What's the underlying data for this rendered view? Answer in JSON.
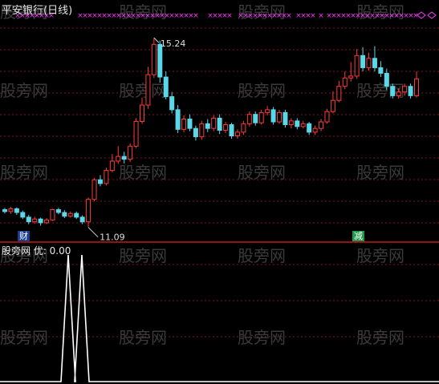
{
  "title": "平安银行(日线)",
  "indicator_label": "股旁网 优: 0.00",
  "badges": {
    "left": "财",
    "right": "减"
  },
  "watermark": "股旁网",
  "colors": {
    "up": "#ff3a3a",
    "down": "#5ad7e8",
    "cross": "#ff33ff",
    "grid": "#7a1a1a",
    "divider": "#c01a1a",
    "line": "#ffffff"
  },
  "chart_data": [
    {
      "type": "candlestick",
      "title": "平安银行(日线)",
      "ylim": [
        10.9,
        15.5
      ],
      "high_label": "15.24",
      "low_label": "11.09",
      "candles": [
        [
          11.56,
          11.52,
          11.6,
          11.48
        ],
        [
          11.52,
          11.58,
          11.62,
          11.47
        ],
        [
          11.58,
          11.5,
          11.61,
          11.45
        ],
        [
          11.5,
          11.4,
          11.54,
          11.36
        ],
        [
          11.4,
          11.3,
          11.45,
          11.25
        ],
        [
          11.3,
          11.36,
          11.41,
          11.26
        ],
        [
          11.36,
          11.28,
          11.39,
          11.22
        ],
        [
          11.28,
          11.34,
          11.38,
          11.25
        ],
        [
          11.34,
          11.56,
          11.58,
          11.32
        ],
        [
          11.56,
          11.5,
          11.6,
          11.46
        ],
        [
          11.5,
          11.42,
          11.55,
          11.38
        ],
        [
          11.42,
          11.48,
          11.52,
          11.39
        ],
        [
          11.48,
          11.4,
          11.52,
          11.36
        ],
        [
          11.4,
          11.3,
          11.44,
          11.25
        ],
        [
          11.3,
          11.78,
          11.82,
          11.18
        ],
        [
          11.78,
          12.2,
          12.24,
          11.74
        ],
        [
          12.2,
          12.12,
          12.3,
          12.06
        ],
        [
          12.12,
          12.4,
          12.46,
          12.08
        ],
        [
          12.4,
          12.6,
          12.75,
          12.36
        ],
        [
          12.6,
          12.7,
          12.92,
          12.54
        ],
        [
          12.7,
          12.64,
          12.8,
          12.55
        ],
        [
          12.64,
          12.92,
          12.98,
          12.58
        ],
        [
          12.92,
          13.45,
          13.52,
          12.88
        ],
        [
          13.45,
          13.8,
          13.96,
          13.4
        ],
        [
          13.8,
          14.45,
          14.62,
          13.72
        ],
        [
          14.45,
          15.1,
          15.24,
          14.38
        ],
        [
          15.1,
          14.4,
          15.18,
          14.28
        ],
        [
          14.4,
          13.98,
          14.52,
          13.92
        ],
        [
          13.98,
          13.7,
          14.08,
          13.62
        ],
        [
          13.7,
          13.28,
          13.8,
          13.2
        ],
        [
          13.28,
          13.5,
          13.58,
          13.22
        ],
        [
          13.5,
          13.3,
          13.6,
          13.24
        ],
        [
          13.3,
          13.12,
          13.36,
          13.04
        ],
        [
          13.12,
          13.4,
          13.46,
          13.06
        ],
        [
          13.4,
          13.3,
          13.5,
          13.22
        ],
        [
          13.3,
          13.52,
          13.58,
          13.24
        ],
        [
          13.52,
          13.26,
          13.6,
          13.18
        ],
        [
          13.26,
          13.38,
          13.44,
          13.2
        ],
        [
          13.38,
          13.14,
          13.42,
          13.08
        ],
        [
          13.14,
          13.22,
          13.28,
          13.08
        ],
        [
          13.22,
          13.4,
          13.46,
          13.16
        ],
        [
          13.4,
          13.6,
          13.66,
          13.34
        ],
        [
          13.6,
          13.42,
          13.66,
          13.36
        ],
        [
          13.42,
          13.64,
          13.7,
          13.38
        ],
        [
          13.64,
          13.7,
          13.78,
          13.58
        ],
        [
          13.7,
          13.44,
          13.76,
          13.38
        ],
        [
          13.44,
          13.64,
          13.7,
          13.4
        ],
        [
          13.64,
          13.38,
          13.7,
          13.32
        ],
        [
          13.38,
          13.46,
          13.52,
          13.3
        ],
        [
          13.46,
          13.34,
          13.52,
          13.28
        ],
        [
          13.34,
          13.4,
          13.46,
          13.3
        ],
        [
          13.4,
          13.22,
          13.44,
          13.16
        ],
        [
          13.22,
          13.3,
          13.36,
          13.16
        ],
        [
          13.3,
          13.44,
          13.5,
          13.24
        ],
        [
          13.44,
          13.66,
          13.72,
          13.4
        ],
        [
          13.66,
          13.9,
          14.1,
          13.62
        ],
        [
          13.9,
          14.2,
          14.32,
          13.86
        ],
        [
          14.2,
          14.38,
          14.52,
          14.14
        ],
        [
          14.38,
          14.42,
          14.72,
          14.3
        ],
        [
          14.42,
          14.86,
          15.0,
          14.36
        ],
        [
          14.86,
          14.6,
          15.04,
          14.52
        ],
        [
          14.6,
          14.8,
          14.92,
          14.54
        ],
        [
          14.8,
          14.6,
          15.06,
          14.52
        ],
        [
          14.6,
          14.48,
          14.74,
          14.4
        ],
        [
          14.48,
          14.2,
          14.58,
          14.12
        ],
        [
          14.2,
          14.0,
          14.26,
          13.94
        ],
        [
          14.0,
          14.08,
          14.16,
          13.94
        ],
        [
          14.08,
          14.2,
          14.26,
          14.0
        ],
        [
          14.2,
          14.0,
          14.26,
          13.94
        ],
        [
          14.0,
          14.36,
          14.52,
          13.96
        ]
      ]
    },
    {
      "type": "line",
      "name": "优",
      "value_label": "0.00",
      "ylim": [
        0,
        1
      ],
      "values": [
        0,
        0,
        0,
        0,
        0,
        0,
        0,
        0,
        0,
        0,
        0,
        0,
        0,
        0,
        0,
        0,
        0,
        0,
        0,
        0,
        0,
        0,
        0,
        0,
        0,
        0,
        0,
        0,
        0,
        0,
        0,
        0,
        0,
        0,
        0,
        0,
        0,
        0,
        0,
        0,
        0,
        0,
        0,
        0,
        0,
        0,
        0,
        0,
        0,
        0,
        0,
        0,
        0,
        0,
        0,
        0,
        0,
        0,
        0,
        0,
        0,
        0,
        0,
        0,
        0,
        0,
        0,
        0,
        0,
        0
      ],
      "spikes": [
        {
          "x": 85,
          "v": 1.0
        },
        {
          "x": 102,
          "v": 1.0
        }
      ]
    }
  ]
}
